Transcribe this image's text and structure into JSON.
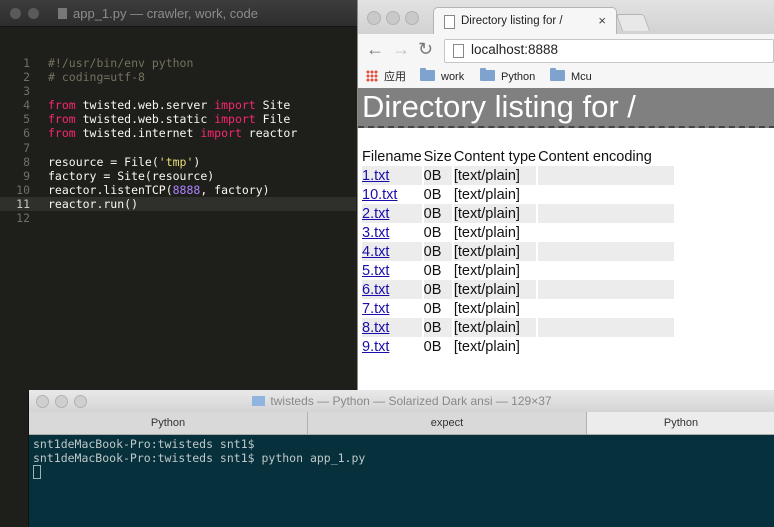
{
  "editor": {
    "title": "app_1.py — crawler, work, code",
    "lines": [
      {
        "n": "1",
        "parts": [
          [
            "cm",
            "#!/usr/bin/env python"
          ]
        ]
      },
      {
        "n": "2",
        "parts": [
          [
            "cm",
            "# coding=utf-8"
          ]
        ]
      },
      {
        "n": "3",
        "parts": []
      },
      {
        "n": "4",
        "parts": [
          [
            "kw",
            "from"
          ],
          [
            "tx",
            " twisted.web.server "
          ],
          [
            "kw",
            "import"
          ],
          [
            "tx",
            " Site"
          ]
        ]
      },
      {
        "n": "5",
        "parts": [
          [
            "kw",
            "from"
          ],
          [
            "tx",
            " twisted.web.static "
          ],
          [
            "kw",
            "import"
          ],
          [
            "tx",
            " File"
          ]
        ]
      },
      {
        "n": "6",
        "parts": [
          [
            "kw",
            "from"
          ],
          [
            "tx",
            " twisted.internet "
          ],
          [
            "kw",
            "import"
          ],
          [
            "tx",
            " reactor"
          ]
        ]
      },
      {
        "n": "7",
        "parts": []
      },
      {
        "n": "8",
        "parts": [
          [
            "tx",
            "resource = File("
          ],
          [
            "st",
            "'tmp'"
          ],
          [
            "tx",
            ")"
          ]
        ]
      },
      {
        "n": "9",
        "parts": [
          [
            "tx",
            "factory = Site(resource)"
          ]
        ]
      },
      {
        "n": "10",
        "parts": [
          [
            "tx",
            "reactor.listenTCP("
          ],
          [
            "nu",
            "8888"
          ],
          [
            "tx",
            ", factory)"
          ]
        ]
      },
      {
        "n": "11",
        "parts": [
          [
            "tx",
            "reactor.run()"
          ]
        ],
        "current": true
      },
      {
        "n": "12",
        "parts": []
      }
    ]
  },
  "browser": {
    "tab_title": "Directory listing for /",
    "tab_close": "×",
    "url": "localhost:8888",
    "nav": {
      "back": "←",
      "forward": "→",
      "reload": "↻"
    },
    "bookmarks": [
      {
        "label": "应用",
        "icon": "apps-grid-icon"
      },
      {
        "label": "work",
        "icon": "folder-icon"
      },
      {
        "label": "Python",
        "icon": "folder-icon"
      },
      {
        "label": "Mcu",
        "icon": "folder-icon"
      }
    ],
    "heading": "Directory listing for /",
    "columns": [
      "Filename",
      "Size",
      "Content type",
      "Content encoding"
    ],
    "rows": [
      {
        "name": "1.txt",
        "size": "0B",
        "type": "[text/plain]",
        "encoding": ""
      },
      {
        "name": "10.txt",
        "size": "0B",
        "type": "[text/plain]",
        "encoding": ""
      },
      {
        "name": "2.txt",
        "size": "0B",
        "type": "[text/plain]",
        "encoding": ""
      },
      {
        "name": "3.txt",
        "size": "0B",
        "type": "[text/plain]",
        "encoding": ""
      },
      {
        "name": "4.txt",
        "size": "0B",
        "type": "[text/plain]",
        "encoding": ""
      },
      {
        "name": "5.txt",
        "size": "0B",
        "type": "[text/plain]",
        "encoding": ""
      },
      {
        "name": "6.txt",
        "size": "0B",
        "type": "[text/plain]",
        "encoding": ""
      },
      {
        "name": "7.txt",
        "size": "0B",
        "type": "[text/plain]",
        "encoding": ""
      },
      {
        "name": "8.txt",
        "size": "0B",
        "type": "[text/plain]",
        "encoding": ""
      },
      {
        "name": "9.txt",
        "size": "0B",
        "type": "[text/plain]",
        "encoding": ""
      }
    ]
  },
  "terminal": {
    "title": "twisteds — Python — Solarized Dark ansi — 129×37",
    "tabs": [
      "Python",
      "expect",
      "Python"
    ],
    "lines": [
      "snt1deMacBook-Pro:twisteds snt1$",
      "snt1deMacBook-Pro:twisteds snt1$ python app_1.py"
    ]
  },
  "colors": {
    "editor_bg": "#1e1f1b",
    "keyword": "#f92672",
    "comment": "#75715e",
    "string": "#e6db74",
    "number": "#ae81ff",
    "link": "#1a0dab",
    "terminal_bg": "#06303b"
  }
}
